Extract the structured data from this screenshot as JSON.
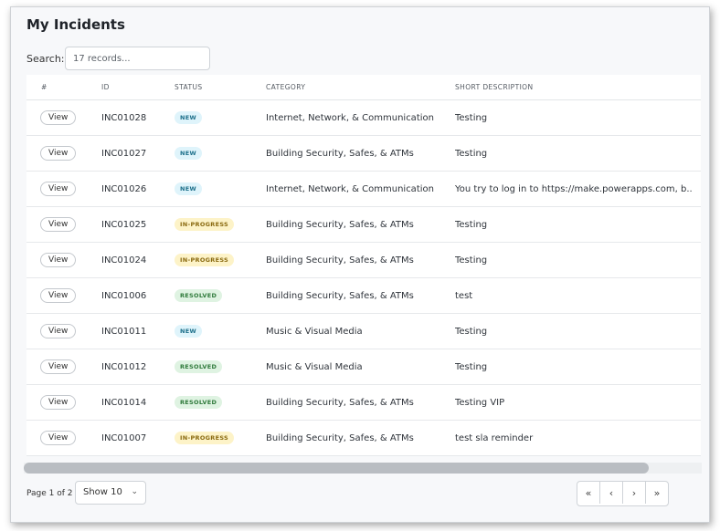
{
  "title": "My Incidents",
  "search": {
    "label": "Search:",
    "placeholder": "17 records..."
  },
  "table": {
    "columns": [
      "#",
      "ID",
      "STATUS",
      "CATEGORY",
      "SHORT DESCRIPTION"
    ],
    "rows": [
      {
        "action": "View",
        "id": "INC01028",
        "status": "NEW",
        "status_type": "new",
        "category": "Internet, Network, & Communication",
        "description": "Testing"
      },
      {
        "action": "View",
        "id": "INC01027",
        "status": "NEW",
        "status_type": "new",
        "category": "Building Security, Safes, & ATMs",
        "description": "Testing"
      },
      {
        "action": "View",
        "id": "INC01026",
        "status": "NEW",
        "status_type": "new",
        "category": "Internet, Network, & Communication",
        "description": "You try to log in to https://make.powerapps.com, b.."
      },
      {
        "action": "View",
        "id": "INC01025",
        "status": "IN-PROGRESS",
        "status_type": "inprog",
        "category": "Building Security, Safes, & ATMs",
        "description": "Testing"
      },
      {
        "action": "View",
        "id": "INC01024",
        "status": "IN-PROGRESS",
        "status_type": "inprog",
        "category": "Building Security, Safes, & ATMs",
        "description": "Testing"
      },
      {
        "action": "View",
        "id": "INC01006",
        "status": "RESOLVED",
        "status_type": "resolved",
        "category": "Building Security, Safes, & ATMs",
        "description": "test"
      },
      {
        "action": "View",
        "id": "INC01011",
        "status": "NEW",
        "status_type": "new",
        "category": "Music & Visual Media",
        "description": "Testing"
      },
      {
        "action": "View",
        "id": "INC01012",
        "status": "RESOLVED",
        "status_type": "resolved",
        "category": "Music & Visual Media",
        "description": "Testing"
      },
      {
        "action": "View",
        "id": "INC01014",
        "status": "RESOLVED",
        "status_type": "resolved",
        "category": "Building Security, Safes, & ATMs",
        "description": "Testing VIP"
      },
      {
        "action": "View",
        "id": "INC01007",
        "status": "IN-PROGRESS",
        "status_type": "inprog",
        "category": "Building Security, Safes, & ATMs",
        "description": "test sla reminder"
      }
    ]
  },
  "pagination": {
    "page_label": "Page 1 of 2",
    "show_value": "Show 10",
    "buttons": [
      {
        "icon": "first-page-icon",
        "glyph": "«"
      },
      {
        "icon": "prev-page-icon",
        "glyph": "‹"
      },
      {
        "icon": "next-page-icon",
        "glyph": "›"
      },
      {
        "icon": "last-page-icon",
        "glyph": "»"
      }
    ]
  },
  "colors": {
    "new_badge": "#dff4fb",
    "inprogress_badge": "#fdf3c8",
    "resolved_badge": "#dff3e2"
  }
}
